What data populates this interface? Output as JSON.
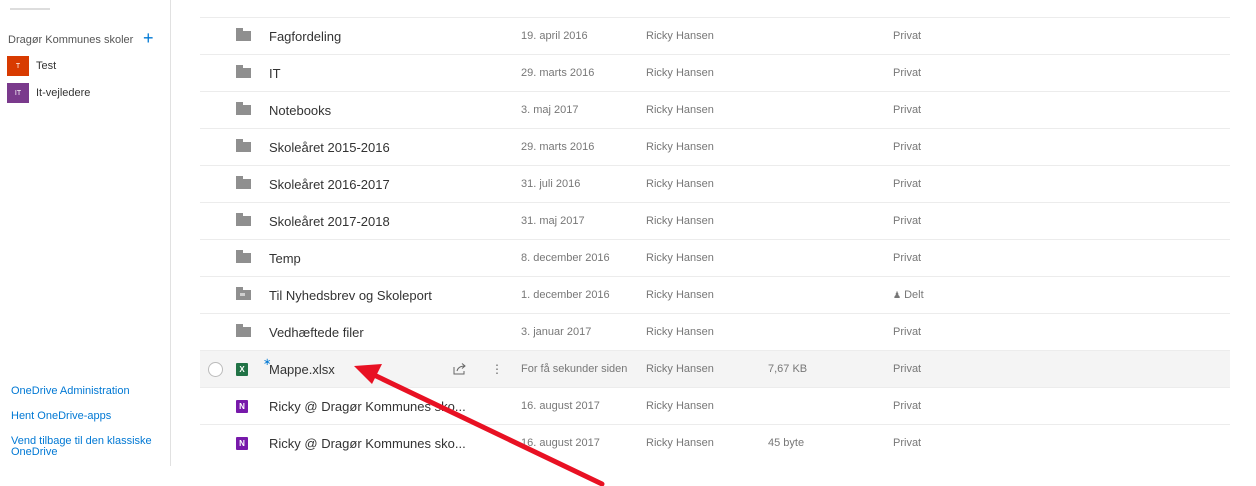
{
  "sidebar": {
    "group_header": "Dragør Kommunes skoler",
    "add_icon": "plus-icon",
    "groups": [
      {
        "initial": "T",
        "label": "Test",
        "color": "#d83b01"
      },
      {
        "initial": "IT",
        "label": "It-vejledere",
        "color": "#7a3a8c"
      }
    ],
    "links": {
      "admin": "OneDrive Administration",
      "apps": "Hent OneDrive-apps",
      "classic_line1": "Vend tilbage til den klassiske",
      "classic_line2": "OneDrive"
    }
  },
  "files": [
    {
      "name": "Fagfordeling",
      "modified": "19. april 2016",
      "by": "Ricky Hansen",
      "size": "",
      "sharing": "Privat",
      "icon": "folder-icon"
    },
    {
      "name": "IT",
      "modified": "29. marts 2016",
      "by": "Ricky Hansen",
      "size": "",
      "sharing": "Privat",
      "icon": "folder-icon"
    },
    {
      "name": "Notebooks",
      "modified": "3. maj 2017",
      "by": "Ricky Hansen",
      "size": "",
      "sharing": "Privat",
      "icon": "folder-icon"
    },
    {
      "name": "Skoleåret 2015-2016",
      "modified": "29. marts 2016",
      "by": "Ricky Hansen",
      "size": "",
      "sharing": "Privat",
      "icon": "folder-icon"
    },
    {
      "name": "Skoleåret 2016-2017",
      "modified": "31. juli 2016",
      "by": "Ricky Hansen",
      "size": "",
      "sharing": "Privat",
      "icon": "folder-icon"
    },
    {
      "name": "Skoleåret 2017-2018",
      "modified": "31. maj 2017",
      "by": "Ricky Hansen",
      "size": "",
      "sharing": "Privat",
      "icon": "folder-icon"
    },
    {
      "name": "Temp",
      "modified": "8. december 2016",
      "by": "Ricky Hansen",
      "size": "",
      "sharing": "Privat",
      "icon": "folder-icon"
    },
    {
      "name": "Til Nyhedsbrev og Skoleport",
      "modified": "1. december 2016",
      "by": "Ricky Hansen",
      "size": "",
      "sharing": "Delt",
      "icon": "shared-folder-icon"
    },
    {
      "name": "Vedhæftede filer",
      "modified": "3. januar 2017",
      "by": "Ricky Hansen",
      "size": "",
      "sharing": "Privat",
      "icon": "folder-icon"
    },
    {
      "name": "Mappe.xlsx",
      "modified": "For få sekunder siden",
      "by": "Ricky Hansen",
      "size": "7,67 KB",
      "sharing": "Privat",
      "icon": "excel-file-icon",
      "badge": "X",
      "new_icon": "new-file-icon"
    },
    {
      "name": "Ricky @ Dragør Kommunes sko...",
      "modified": "16. august 2017",
      "by": "Ricky Hansen",
      "size": "",
      "sharing": "Privat",
      "icon": "onenote-file-icon",
      "badge": "N"
    },
    {
      "name": "Ricky @ Dragør Kommunes sko...",
      "modified": "16. august 2017",
      "by": "Ricky Hansen",
      "size": "45 byte",
      "sharing": "Privat",
      "icon": "onenote-file-icon",
      "badge": "N"
    }
  ],
  "row_actions": {
    "share_icon": "share-icon",
    "more_icon": "more-vertical-icon"
  },
  "annotation": {
    "icon": "red-arrow-icon",
    "color": "#e81123"
  }
}
